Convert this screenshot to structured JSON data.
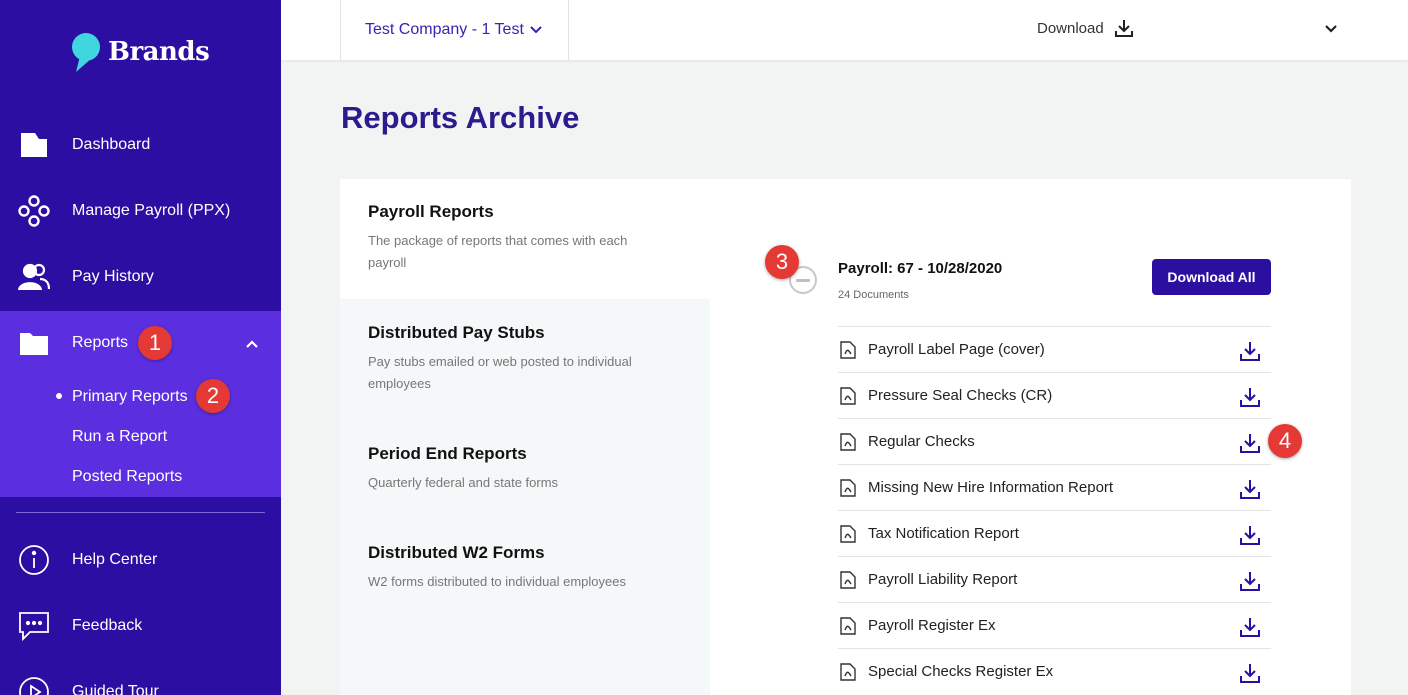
{
  "sidebar": {
    "brand": "Brands",
    "items": [
      {
        "label": "Dashboard",
        "icon": "dashboard-icon"
      },
      {
        "label": "Manage Payroll (PPX)",
        "icon": "payroll-icon"
      },
      {
        "label": "Pay History",
        "icon": "people-icon"
      },
      {
        "label": "Reports",
        "icon": "folder-icon"
      }
    ],
    "sub_items": [
      "Primary Reports",
      "Run a Report",
      "Posted Reports"
    ],
    "bottom_items": [
      {
        "label": "Help Center",
        "icon": "info-icon"
      },
      {
        "label": "Feedback",
        "icon": "chat-icon"
      },
      {
        "label": "Guided Tour",
        "icon": "play-icon"
      }
    ]
  },
  "badges": [
    "1",
    "2",
    "3",
    "4"
  ],
  "topbar": {
    "company": "Test Company - 1 Test",
    "download_label": "Download"
  },
  "page": {
    "title": "Reports Archive"
  },
  "categories": [
    {
      "title": "Payroll Reports",
      "desc": "The package of reports that comes with each payroll"
    },
    {
      "title": "Distributed Pay Stubs",
      "desc": "Pay stubs emailed or web posted to individual employees"
    },
    {
      "title": "Period End Reports",
      "desc": "Quarterly federal and state forms"
    },
    {
      "title": "Distributed W2 Forms",
      "desc": "W2 forms distributed to individual employees"
    }
  ],
  "payroll": {
    "heading": "Payroll: 67 - 10/28/2020",
    "doc_count": "24 Documents",
    "download_all": "Download All",
    "documents": [
      "Payroll Label Page (cover)",
      "Pressure Seal Checks (CR)",
      "Regular Checks",
      "Missing New Hire Information Report",
      "Tax Notification Report",
      "Payroll Liability Report",
      "Payroll Register Ex",
      "Special Checks Register Ex"
    ]
  },
  "colors": {
    "sidebar": "#2c0fa2",
    "sidebar_active": "#5b2fe0",
    "accent": "#2a0fa0",
    "badge": "#e53935",
    "logo_accent": "#3fd6e0"
  }
}
